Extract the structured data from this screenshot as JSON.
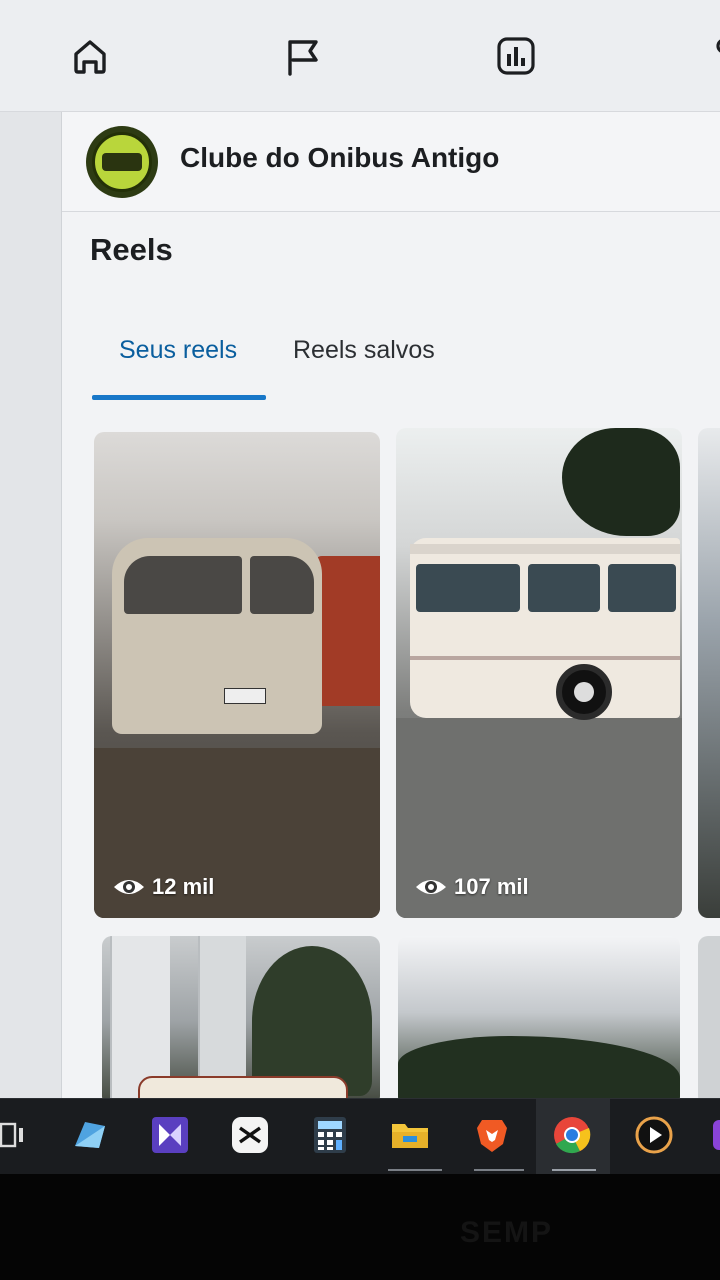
{
  "top_nav": {
    "icons": [
      "home-icon",
      "flag-icon",
      "insights-icon",
      "more-icon"
    ]
  },
  "page": {
    "name": "Clube do Onibus Antigo"
  },
  "reels": {
    "title": "Reels",
    "tabs": [
      {
        "label": "Seus reels",
        "active": true
      },
      {
        "label": "Reels salvos",
        "active": false
      }
    ],
    "items": [
      {
        "views": "12 mil"
      },
      {
        "views": "107 mil"
      }
    ]
  },
  "taskbar": {
    "apps": [
      "task-view-icon",
      "mail-icon",
      "video-editor-icon",
      "capcut-icon",
      "calculator-icon",
      "file-explorer-icon",
      "brave-icon",
      "chrome-icon",
      "media-player-icon",
      "app-icon"
    ],
    "active_app": "chrome-icon"
  },
  "device": {
    "brand": "SEMP"
  },
  "colors": {
    "accent": "#1877c8",
    "active_tab_text": "#0a5e9e",
    "taskbar": "#1a1c1f"
  }
}
